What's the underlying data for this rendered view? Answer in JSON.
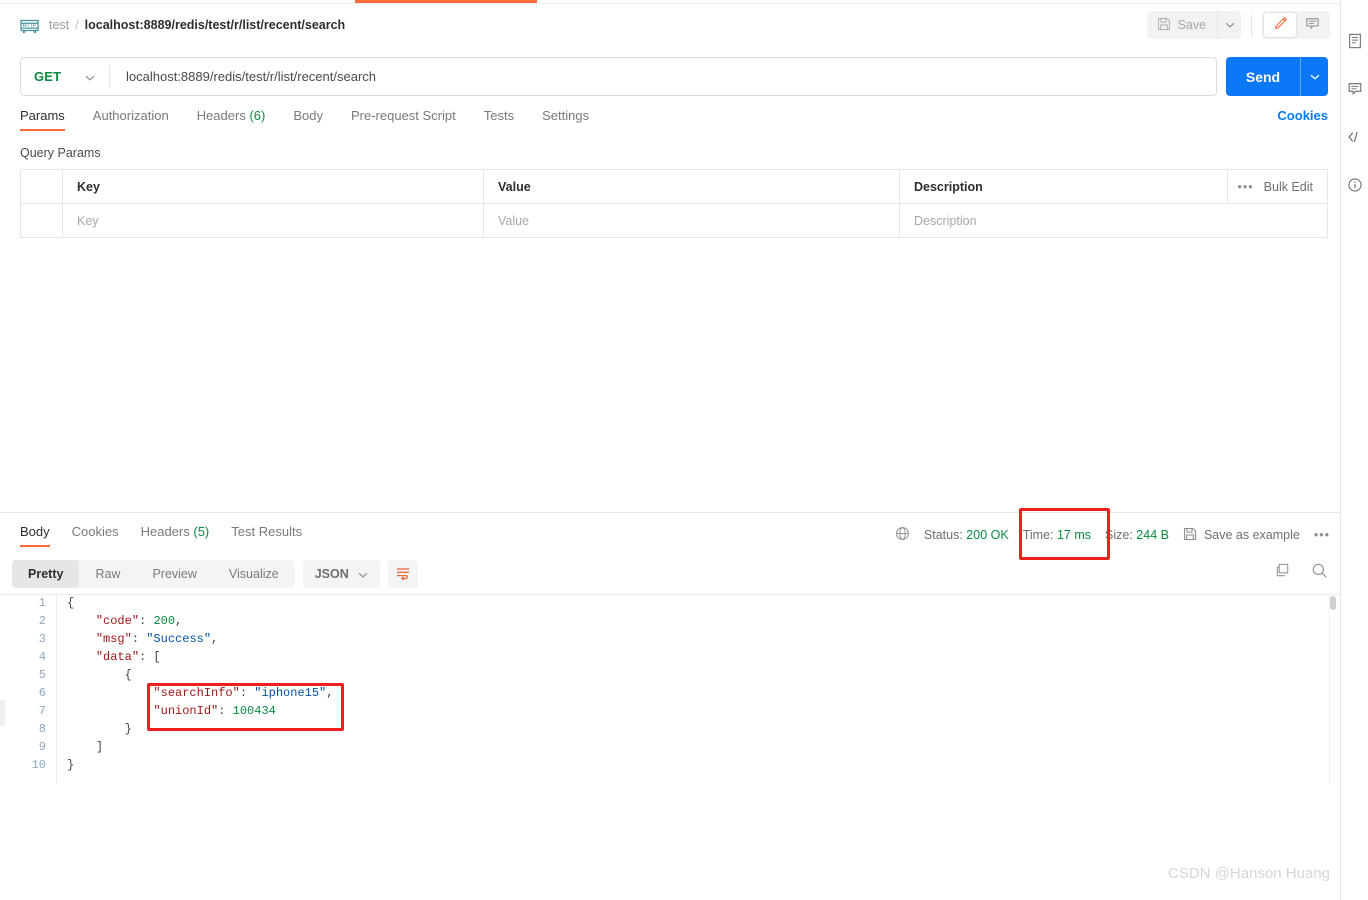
{
  "breadcrumb": {
    "protocol_icon": "http-icon",
    "workspace": "test",
    "separator": "/",
    "request_name": "localhost:8889/redis/test/r/list/recent/search"
  },
  "toolbar": {
    "save_label": "Save",
    "save_icon": "floppy-disk-icon",
    "save_caret_icon": "chevron-down-icon",
    "edit_icon": "pencil-icon",
    "comment_icon": "comment-icon"
  },
  "url_bar": {
    "method": "GET",
    "method_caret_icon": "chevron-down-icon",
    "url": "localhost:8889/redis/test/r/list/recent/search",
    "send_label": "Send",
    "send_caret_icon": "chevron-down-icon"
  },
  "request_tabs": {
    "items": [
      {
        "label": "Params",
        "count": "",
        "active": true
      },
      {
        "label": "Authorization",
        "count": "",
        "active": false
      },
      {
        "label": "Headers",
        "count": "(6)",
        "active": false
      },
      {
        "label": "Body",
        "count": "",
        "active": false
      },
      {
        "label": "Pre-request Script",
        "count": "",
        "active": false
      },
      {
        "label": "Tests",
        "count": "",
        "active": false
      },
      {
        "label": "Settings",
        "count": "",
        "active": false
      }
    ],
    "cookies_label": "Cookies"
  },
  "query_params": {
    "section_title": "Query Params",
    "headers": {
      "key": "Key",
      "value": "Value",
      "description": "Description"
    },
    "bulk_edit_label": "Bulk Edit",
    "more_icon": "ellipsis-icon",
    "rows": [
      {
        "key": "Key",
        "value": "Value",
        "description": "Description"
      }
    ]
  },
  "response_tabs": {
    "items": [
      {
        "label": "Body",
        "count": "",
        "active": true
      },
      {
        "label": "Cookies",
        "count": "",
        "active": false
      },
      {
        "label": "Headers",
        "count": "(5)",
        "active": false
      },
      {
        "label": "Test Results",
        "count": "",
        "active": false
      }
    ]
  },
  "response_meta": {
    "globe_icon": "globe-icon",
    "status_label": "Status:",
    "status_value": "200 OK",
    "time_label": "Time:",
    "time_value": "17 ms",
    "size_label": "Size:",
    "size_value": "244 B",
    "save_example_label": "Save as example",
    "save_example_icon": "floppy-disk-icon",
    "more_icon": "ellipsis-icon"
  },
  "format_bar": {
    "modes": [
      {
        "label": "Pretty",
        "active": true
      },
      {
        "label": "Raw",
        "active": false
      },
      {
        "label": "Preview",
        "active": false
      },
      {
        "label": "Visualize",
        "active": false
      }
    ],
    "language": "JSON",
    "language_caret_icon": "chevron-down-icon",
    "wrap_icon": "word-wrap-icon",
    "copy_icon": "copy-icon",
    "search_icon": "search-icon"
  },
  "response_body": {
    "line_numbers": [
      "1",
      "2",
      "3",
      "4",
      "5",
      "6",
      "7",
      "8",
      "9",
      "10"
    ],
    "lines": [
      {
        "indent": 0,
        "tokens": [
          {
            "t": "pun",
            "v": "{"
          }
        ]
      },
      {
        "indent": 1,
        "tokens": [
          {
            "t": "key",
            "v": "\"code\""
          },
          {
            "t": "pun",
            "v": ": "
          },
          {
            "t": "num",
            "v": "200"
          },
          {
            "t": "pun",
            "v": ","
          }
        ]
      },
      {
        "indent": 1,
        "tokens": [
          {
            "t": "key",
            "v": "\"msg\""
          },
          {
            "t": "pun",
            "v": ": "
          },
          {
            "t": "str",
            "v": "\"Success\""
          },
          {
            "t": "pun",
            "v": ","
          }
        ]
      },
      {
        "indent": 1,
        "tokens": [
          {
            "t": "key",
            "v": "\"data\""
          },
          {
            "t": "pun",
            "v": ": ["
          }
        ]
      },
      {
        "indent": 2,
        "tokens": [
          {
            "t": "pun",
            "v": "{"
          }
        ]
      },
      {
        "indent": 3,
        "tokens": [
          {
            "t": "key",
            "v": "\"searchInfo\""
          },
          {
            "t": "pun",
            "v": ": "
          },
          {
            "t": "str",
            "v": "\"iphone15\""
          },
          {
            "t": "pun",
            "v": ","
          }
        ]
      },
      {
        "indent": 3,
        "tokens": [
          {
            "t": "key",
            "v": "\"unionId\""
          },
          {
            "t": "pun",
            "v": ": "
          },
          {
            "t": "num",
            "v": "100434"
          }
        ]
      },
      {
        "indent": 2,
        "tokens": [
          {
            "t": "pun",
            "v": "}"
          }
        ]
      },
      {
        "indent": 1,
        "tokens": [
          {
            "t": "pun",
            "v": "]"
          }
        ]
      },
      {
        "indent": 0,
        "tokens": [
          {
            "t": "pun",
            "v": "}"
          }
        ]
      }
    ]
  },
  "right_rail": {
    "items": [
      {
        "icon": "documentation-icon"
      },
      {
        "icon": "comment-icon"
      },
      {
        "icon": "code-icon"
      },
      {
        "icon": "info-icon"
      }
    ]
  },
  "annotations": [
    {
      "name": "time-highlight",
      "color": "#f01e1e"
    },
    {
      "name": "json-data-highlight",
      "color": "#f01e1e"
    }
  ],
  "watermark": {
    "text": "CSDN @Hanson Huang"
  },
  "colors": {
    "accent_orange": "#ff6c37",
    "send_blue": "#0b79f7",
    "status_green": "#0b8a3e",
    "annotation_red": "#f01e1e"
  }
}
